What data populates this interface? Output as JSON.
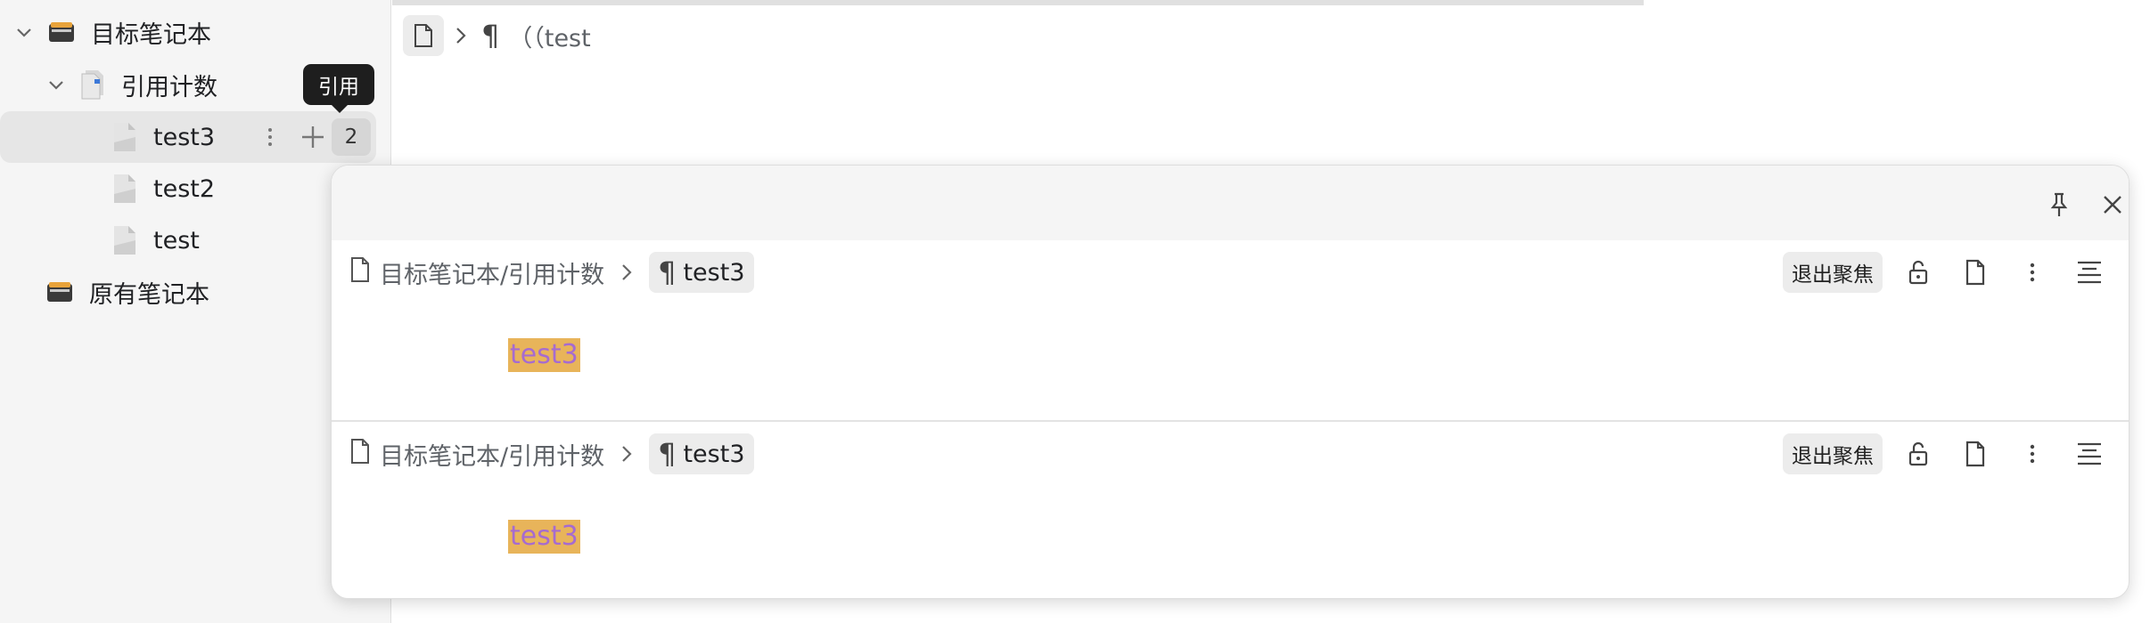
{
  "sidebar": {
    "items": [
      {
        "label": "目标笔记本",
        "icon": "notebook-icon"
      },
      {
        "label": "引用计数",
        "icon": "document-icon"
      },
      {
        "label": "test3",
        "icon": "document-icon",
        "ref_count": "2"
      },
      {
        "label": "test2",
        "icon": "document-icon"
      },
      {
        "label": "test",
        "icon": "document-icon"
      },
      {
        "label": "原有笔记本",
        "icon": "notebook-icon"
      }
    ],
    "tooltip": "引用"
  },
  "editor": {
    "breadcrumb_text": "（（test"
  },
  "popup": {
    "panels": [
      {
        "path": "目标笔记本/引用计数",
        "block": "test3",
        "exit_focus": "退出聚焦",
        "content": "test3"
      },
      {
        "path": "目标笔记本/引用计数",
        "block": "test3",
        "exit_focus": "退出聚焦",
        "content": "test3"
      }
    ]
  },
  "colors": {
    "highlight_bg": "#e8b45a",
    "highlight_text": "#a66bd0",
    "sidebar_bg": "#f5f5f5",
    "tooltip_bg": "#1e1e1e"
  }
}
